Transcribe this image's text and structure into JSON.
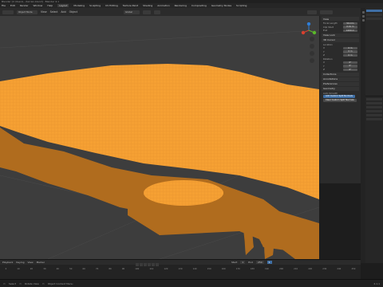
{
  "window": {
    "title": "Blender [C:\\Users\\...\\terrain.blend] - Blender 4.1"
  },
  "menu": {
    "items": [
      "File",
      "Edit",
      "Render",
      "Window",
      "Help",
      "Layout",
      "Modeling",
      "Sculpting",
      "UV Editing",
      "Texture Paint",
      "Shading",
      "Animation",
      "Rendering",
      "Compositing",
      "Geometry Nodes",
      "Scripting"
    ],
    "active_index": 5
  },
  "viewport_header": {
    "mode": "Object Mode",
    "view": "View",
    "select": "Select",
    "add": "Add",
    "object": "Object",
    "orientation": "Global"
  },
  "npanel": {
    "sections": {
      "view": "View",
      "view_lock": "View Lock",
      "cursor": "3D Cursor",
      "collections": "Collections",
      "annotations": "Annotations",
      "preferences": "Preferences",
      "geometry": "Geometry"
    },
    "view_rows": [
      {
        "label": "Focal Length",
        "value": "50 mm"
      },
      {
        "label": "Clip Start",
        "value": "0.01 m"
      },
      {
        "label": "End",
        "value": "1000 m"
      }
    ],
    "location": {
      "label": "Location",
      "x": "0 m",
      "y": "0 m",
      "z": "0 m"
    },
    "rotation": {
      "label": "Rotation",
      "x": "0°",
      "y": "0°",
      "z": "0°"
    },
    "auto_smooth": "Auto Smooth",
    "add_custom_button": "Add Custom Split Normals",
    "clear_button": "Clear Custom Split Normals"
  },
  "timeline": {
    "playback": "Playback",
    "keying": "Keying",
    "view": "View",
    "marker": "Marker",
    "start_label": "Start",
    "start": "1",
    "end_label": "End",
    "end": "250",
    "current_frame": "1",
    "ruler": [
      "0",
      "10",
      "20",
      "30",
      "40",
      "50",
      "60",
      "70",
      "80",
      "90",
      "100",
      "110",
      "120",
      "130",
      "140",
      "150",
      "160",
      "170",
      "180",
      "190",
      "200",
      "210",
      "220",
      "230",
      "240",
      "250"
    ]
  },
  "status": {
    "left": "Select",
    "mid": "Rotate View",
    "right": "Object Context Menu",
    "version": "4.1.1"
  },
  "colors": {
    "terrain": "#f59e2f",
    "terrain_dark": "#b36a1a",
    "viewport_bg": "#3d3d3d",
    "accent": "#3f6fa5"
  }
}
